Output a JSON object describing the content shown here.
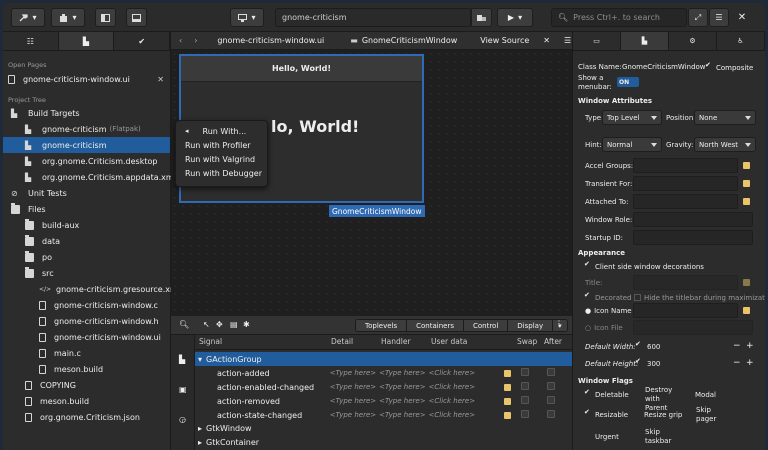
{
  "headerbar": {
    "project_name": "gnome-criticism",
    "search_placeholder": "Press Ctrl+. to search"
  },
  "left": {
    "open_pages_label": "Open Pages",
    "open_page": "gnome-criticism-window.ui",
    "project_tree_label": "Project Tree",
    "items": [
      {
        "label": "Build Targets",
        "depth": 0,
        "icon": "build-icon"
      },
      {
        "label": "gnome-criticism",
        "extra": "(Flatpak)",
        "depth": 1,
        "icon": "build-target-icon"
      },
      {
        "label": "gnome-criticism",
        "depth": 1,
        "icon": "build-target-icon",
        "selected": true
      },
      {
        "label": "org.gnome.Criticism.desktop",
        "depth": 1,
        "icon": "build-target-icon"
      },
      {
        "label": "org.gnome.Criticism.appdata.xml",
        "depth": 1,
        "icon": "build-target-icon"
      },
      {
        "label": "Unit Tests",
        "depth": 0,
        "icon": "test-icon"
      },
      {
        "label": "Files",
        "depth": 0,
        "icon": "folder-icon"
      },
      {
        "label": "build-aux",
        "depth": 1,
        "icon": "folder-icon"
      },
      {
        "label": "data",
        "depth": 1,
        "icon": "folder-icon"
      },
      {
        "label": "po",
        "depth": 1,
        "icon": "folder-icon"
      },
      {
        "label": "src",
        "depth": 1,
        "icon": "folder-icon"
      },
      {
        "label": "gnome-criticism.gresource.xml",
        "depth": 2,
        "icon": "code-icon"
      },
      {
        "label": "gnome-criticism-window.c",
        "depth": 2,
        "icon": "file-icon"
      },
      {
        "label": "gnome-criticism-window.h",
        "depth": 2,
        "icon": "file-icon"
      },
      {
        "label": "gnome-criticism-window.ui",
        "depth": 2,
        "icon": "file-icon"
      },
      {
        "label": "main.c",
        "depth": 2,
        "icon": "file-icon"
      },
      {
        "label": "meson.build",
        "depth": 2,
        "icon": "file-icon"
      },
      {
        "label": "COPYING",
        "depth": 1,
        "icon": "file-icon"
      },
      {
        "label": "meson.build",
        "depth": 1,
        "icon": "file-icon"
      },
      {
        "label": "org.gnome.Criticism.json",
        "depth": 1,
        "icon": "file-icon"
      }
    ]
  },
  "editor": {
    "file_tab": "gnome-criticism-window.ui",
    "object_tab": "GnomeCriticismWindow",
    "view_source": "View Source",
    "preview_title": "Hello, World!",
    "preview_body": "lo, World!",
    "window_label": "GnomeCriticismWindow"
  },
  "context_menu": {
    "items": [
      "Run With...",
      "Run with Profiler",
      "Run with Valgrind",
      "Run with Debugger"
    ]
  },
  "bottom": {
    "tabs": [
      "Toplevels",
      "Containers",
      "Control",
      "Display"
    ],
    "columns": [
      "Signal",
      "Detail",
      "Handler",
      "User data",
      "Swap",
      "After"
    ],
    "group": "GActionGroup",
    "signals": [
      "action-added",
      "action-enabled-changed",
      "action-removed",
      "action-state-changed"
    ],
    "type_placeholder": "<Type here>",
    "click_placeholder": "<Click here>",
    "more_groups": [
      "GtkWindow",
      "GtkContainer"
    ]
  },
  "inspector": {
    "class_name_label": "Class Name:",
    "class_name": "GnomeCriticismWindow",
    "composite": "Composite",
    "show_menubar_label": "Show a menubar:",
    "toggle_on": "ON",
    "window_attributes": "Window Attributes",
    "type_label": "Type:",
    "type_value": "Top Level",
    "position_label": "Position:",
    "position_value": "None",
    "hint_label": "Hint:",
    "hint_value": "Normal",
    "gravity_label": "Gravity:",
    "gravity_value": "North West",
    "accel_label": "Accel Groups:",
    "transient_label": "Transient For:",
    "attached_label": "Attached To:",
    "role_label": "Window Role:",
    "startup_label": "Startup ID:",
    "appearance": "Appearance",
    "csd": "Client side window decorations",
    "title_label": "Title:",
    "decorated": "Decorated",
    "hide_titlebar": "Hide the titlebar during maximization",
    "icon_name": "Icon Name",
    "icon_file": "Icon File",
    "default_width_label": "Default Width:",
    "default_width": "600",
    "default_height_label": "Default Height:",
    "default_height": "300",
    "window_flags": "Window Flags",
    "flags": [
      "Deletable",
      "Destroy with Parent",
      "Modal",
      "Resizable",
      "Resize grip",
      "Skip pager",
      "Urgent",
      "Skip taskbar"
    ]
  }
}
